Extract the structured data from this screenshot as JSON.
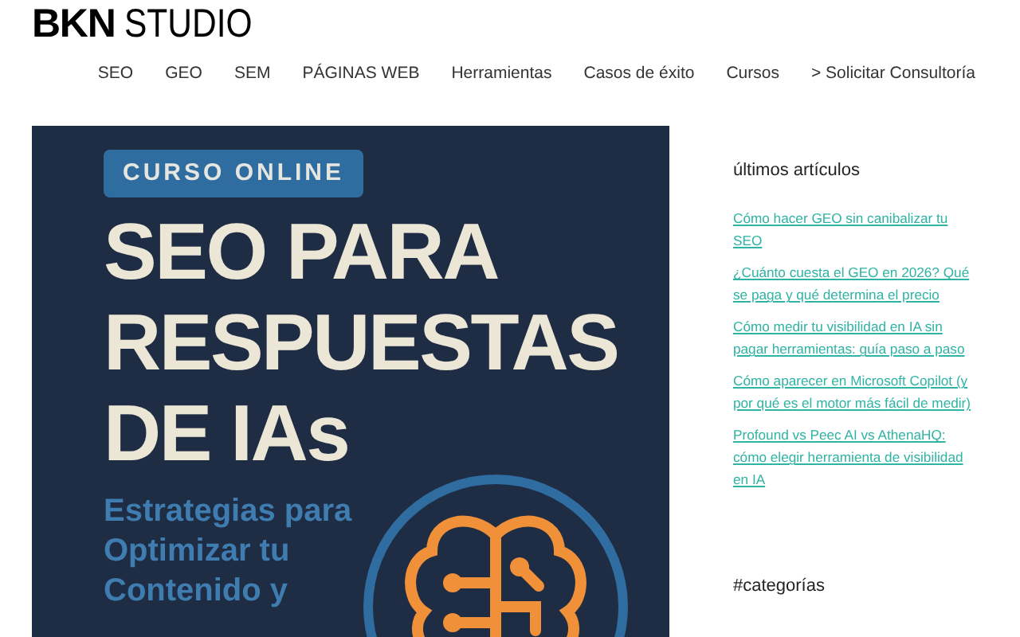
{
  "logo": {
    "bold": "BKN",
    "light": "STUDIO"
  },
  "nav": [
    "SEO",
    "GEO",
    "SEM",
    "PÁGINAS WEB",
    "Herramientas",
    "Casos de éxito",
    "Cursos",
    "> Solicitar Consultoría"
  ],
  "banner": {
    "badge": "CURSO ONLINE",
    "title_lines": [
      "SEO PARA",
      "RESPUESTAS",
      "DE IAs"
    ],
    "subtitle_lines": [
      "Estrategias para",
      "Optimizar tu",
      "Contenido y"
    ]
  },
  "sidebar": {
    "recent_heading": "últimos artículos",
    "articles": [
      "Cómo hacer GEO sin canibalizar tu SEO",
      "¿Cuánto cuesta el GEO en 2026? Qué se paga y qué determina el precio",
      "Cómo medir tu visibilidad en IA sin pagar herramientas: guía paso a paso",
      "Cómo aparecer en Microsoft Copilot (y por qué es el motor más fácil de medir)",
      "Profound vs Peec AI vs AthenaHQ: cómo elegir herramienta de visibilidad en IA"
    ],
    "categories_heading": "#categorías"
  }
}
